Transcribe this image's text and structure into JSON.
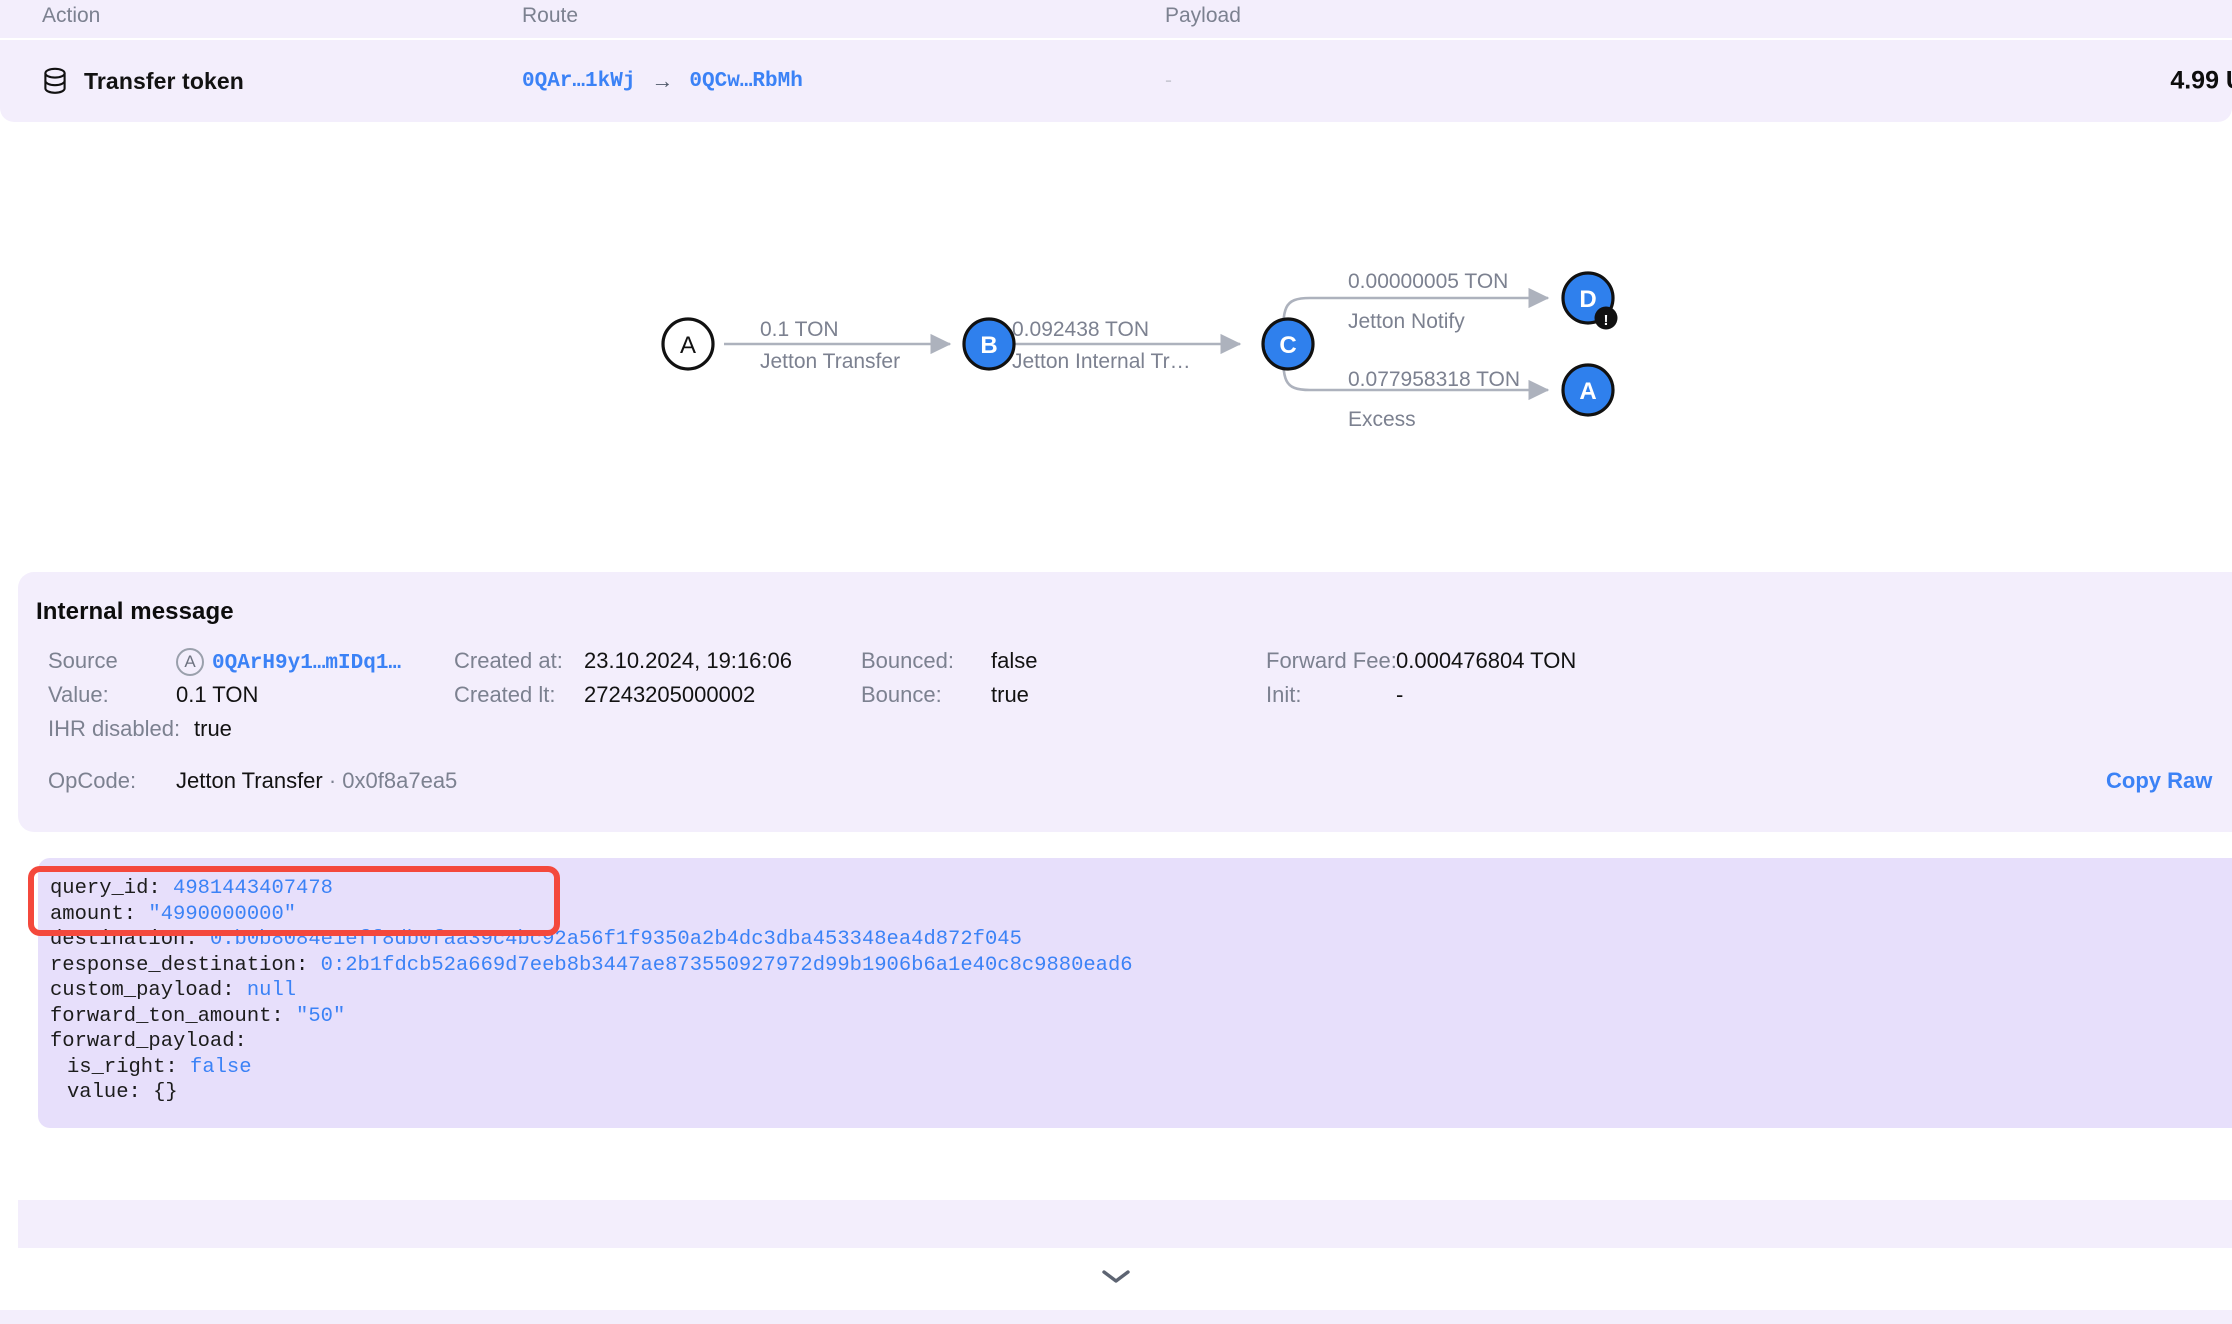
{
  "table": {
    "columns": {
      "action": "Action",
      "route": "Route",
      "payload": "Payload"
    },
    "row": {
      "icon": "database-icon",
      "action": "Transfer token",
      "route_from": "0QAr…1kWj",
      "route_arrow": "→",
      "route_to": "0QCw…RbMh",
      "payload": "-",
      "amount": "4.99 U"
    }
  },
  "graph": {
    "nodes": [
      {
        "id": "A",
        "label": "A",
        "style": "outline"
      },
      {
        "id": "B",
        "label": "B",
        "style": "filled"
      },
      {
        "id": "C",
        "label": "C",
        "style": "filled"
      },
      {
        "id": "D",
        "label": "D",
        "style": "filled",
        "badge": "!"
      },
      {
        "id": "A2",
        "label": "A",
        "style": "filled"
      }
    ],
    "edges": [
      {
        "from": "A",
        "to": "B",
        "amount": "0.1 TON",
        "op": "Jetton Transfer"
      },
      {
        "from": "B",
        "to": "C",
        "amount": "0.092438 TON",
        "op": "Jetton Internal Tr…"
      },
      {
        "from": "C",
        "to": "D",
        "amount": "0.00000005 TON",
        "op": "Jetton Notify"
      },
      {
        "from": "C",
        "to": "A2",
        "amount": "0.077958318 TON",
        "op": "Excess"
      }
    ]
  },
  "internal_message": {
    "title": "Internal message",
    "fields": {
      "source_label": "Source",
      "source_badge": "A",
      "source_value": "0QArH9y1…mIDq1…",
      "value_label": "Value:",
      "value_value": "0.1 TON",
      "ihr_label": "IHR disabled:",
      "ihr_value": "true",
      "created_at_label": "Created at:",
      "created_at_value": "23.10.2024, 19:16:06",
      "created_lt_label": "Created lt:",
      "created_lt_value": "27243205000002",
      "bounced_label": "Bounced:",
      "bounced_value": "false",
      "bounce_label": "Bounce:",
      "bounce_value": "true",
      "forward_fee_label": "Forward Fee:",
      "forward_fee_value": "0.000476804 TON",
      "init_label": "Init:",
      "init_value": "-",
      "opcode_label": "OpCode:",
      "opcode_name": "Jetton Transfer",
      "opcode_hex": " · 0x0f8a7ea5",
      "copy_raw": "Copy Raw"
    },
    "payload_lines": [
      {
        "key": "query_id: ",
        "value": "4981443407478",
        "indent": 0
      },
      {
        "key": "amount: ",
        "value": "\"4990000000\"",
        "indent": 0
      },
      {
        "key": "destination: ",
        "value": "0:b0b8084e1eff8db0faa39c4bc92a56f1f9350a2b4dc3dba453348ea4d872f045",
        "indent": 0
      },
      {
        "key": "response_destination: ",
        "value": "0:2b1fdcb52a669d7eeb8b3447ae873550927972d99b1906b6a1e40c8c9880ead6",
        "indent": 0
      },
      {
        "key": "custom_payload: ",
        "value": "null",
        "indent": 0
      },
      {
        "key": "forward_ton_amount: ",
        "value": "\"50\"",
        "indent": 0
      },
      {
        "key": "forward_payload:",
        "value": "",
        "indent": 0
      },
      {
        "key": "is_right: ",
        "value": "false",
        "indent": 1
      },
      {
        "key": "value: {}",
        "value": "",
        "indent": 1
      }
    ]
  },
  "footer": {
    "expand_icon": "chevron-down-icon"
  },
  "colors": {
    "panel_bg": "#f3eefc",
    "code_bg": "#e7dffb",
    "accent_blue": "#3b82f6",
    "node_blue": "#2f80ed",
    "muted": "#7c8190",
    "highlight_red": "#f4483c"
  }
}
